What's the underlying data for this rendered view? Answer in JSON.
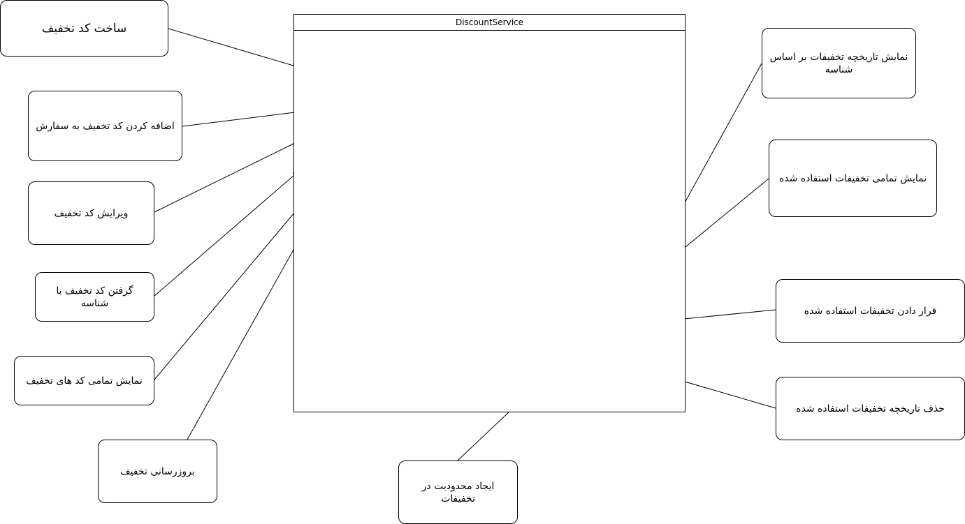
{
  "container": {
    "title": "DiscountService"
  },
  "left_nodes": [
    "ساخت کد تخفیف",
    "اضافه کردن کد تخفیف به سفارش",
    "ویرایش کد تخفیف",
    "گرفتن کد تخفیف با شناسه",
    "نمایش تمامی کد های تخفیف",
    "بروزرسانی تخفیف"
  ],
  "right_nodes": [
    "نمایش تاریخچه تخفیفات بر اساس شناسه",
    "نمایش تمامی تخفیفات استفاده شده",
    "قرار دادن تخفیفات استفاده شده",
    "حذف تاریخچه تخفیفات استفاده شده"
  ],
  "bottom_node": "ایجاد محدودیت در تخفیفات"
}
